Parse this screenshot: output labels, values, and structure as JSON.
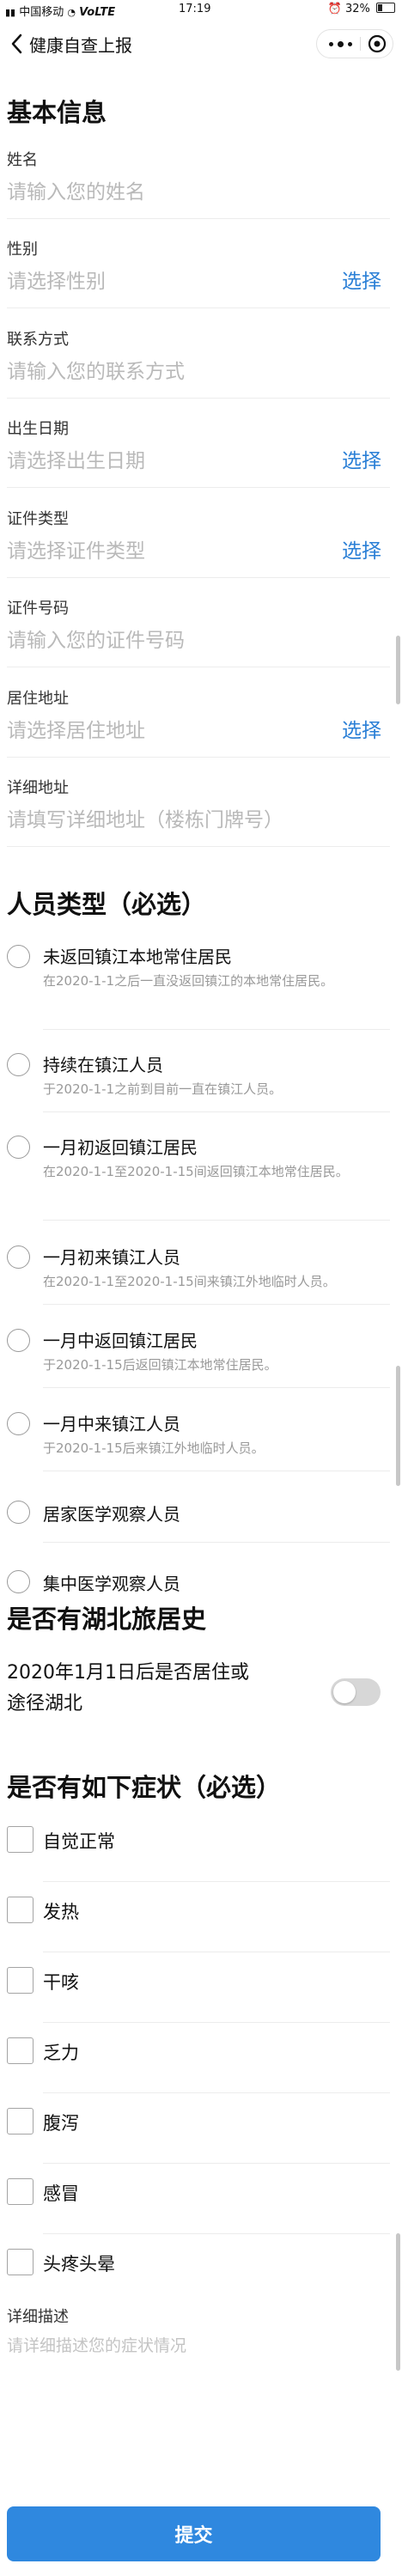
{
  "status_bar": {
    "carrier": "中国移动",
    "network": "VoLTE",
    "time": "17:19",
    "battery": "32%"
  },
  "nav": {
    "title": "健康自查上报"
  },
  "basic_info": {
    "title": "基本信息",
    "fields": [
      {
        "label": "姓名",
        "placeholder": "请输入您的姓名"
      },
      {
        "label": "性别",
        "placeholder": "请选择性别",
        "action": "选择"
      },
      {
        "label": "联系方式",
        "placeholder": "请输入您的联系方式"
      },
      {
        "label": "出生日期",
        "placeholder": "请选择出生日期",
        "action": "选择"
      },
      {
        "label": "证件类型",
        "placeholder": "请选择证件类型",
        "action": "选择"
      },
      {
        "label": "证件号码",
        "placeholder": "请输入您的证件号码"
      },
      {
        "label": "居住地址",
        "placeholder": "请选择居住地址",
        "action": "选择"
      },
      {
        "label": "详细地址",
        "placeholder": "请填写详细地址（楼栋门牌号）"
      }
    ]
  },
  "person_type": {
    "title": "人员类型（必选）",
    "options": [
      {
        "title": "未返回镇江本地常住居民",
        "desc": "在2020-1-1之后一直没返回镇江的本地常住居民。"
      },
      {
        "title": "持续在镇江人员",
        "desc": "于2020-1-1之前到目前一直在镇江人员。"
      },
      {
        "title": "一月初返回镇江居民",
        "desc": "在2020-1-1至2020-1-15间返回镇江本地常住居民。"
      },
      {
        "title": "一月初来镇江人员",
        "desc": "在2020-1-1至2020-1-15间来镇江外地临时人员。"
      },
      {
        "title": "一月中返回镇江居民",
        "desc": "于2020-1-15后返回镇江本地常住居民。"
      },
      {
        "title": "一月中来镇江人员",
        "desc": "于2020-1-15后来镇江外地临时人员。"
      },
      {
        "title": "居家医学观察人员",
        "desc": ""
      },
      {
        "title": "集中医学观察人员",
        "desc": ""
      }
    ]
  },
  "hubei": {
    "title": "是否有湖北旅居史",
    "question_line1": "2020年1月1日后是否居住或",
    "question_line2": "途径湖北",
    "switch_on": false
  },
  "symptoms": {
    "title": "是否有如下症状（必选）",
    "items": [
      "自觉正常",
      "发热",
      "干咳",
      "乏力",
      "腹泻",
      "感冒",
      "头疼头晕"
    ],
    "detail_label": "详细描述",
    "detail_placeholder": "请详细描述您的症状情况"
  },
  "submit": {
    "label": "提交"
  },
  "colors": {
    "accent": "#2a7fd6",
    "button": "#2f88df",
    "placeholder": "#b9b9b9"
  }
}
